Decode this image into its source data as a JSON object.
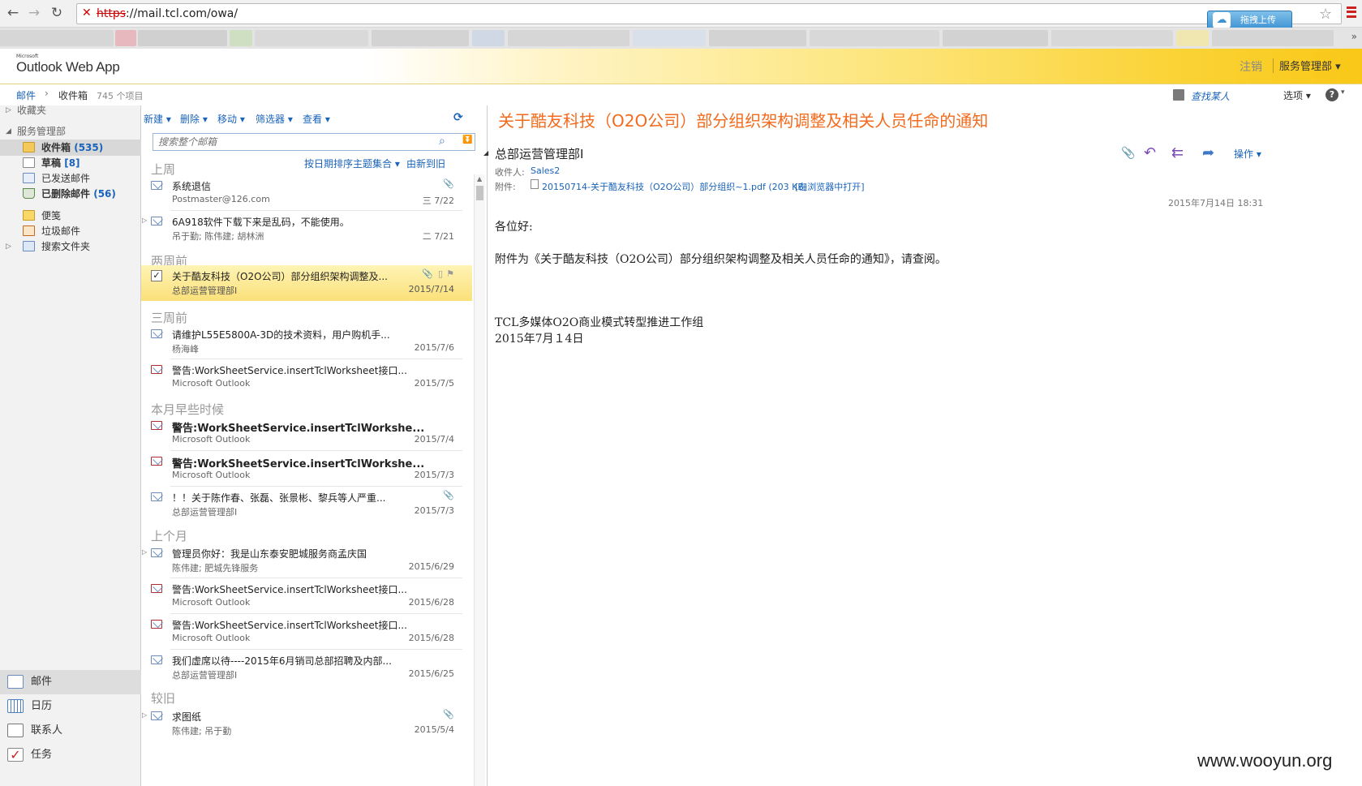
{
  "browser": {
    "url_scheme": "https",
    "url_rest": "://mail.tcl.com/owa/",
    "upload_label": "拖拽上传"
  },
  "header": {
    "logo_small": "Microsoft",
    "logo": "Outlook Web App",
    "logout": "注销",
    "user": "服务管理部 ▾"
  },
  "breadcrumb": {
    "mail": "邮件",
    "sep": "›",
    "inbox": "收件箱",
    "count": "745 个项目",
    "find_people": "查找某人",
    "options": "选项 ▾",
    "help": "?"
  },
  "nav": {
    "favorites": "收藏夹",
    "mailbox": "服务管理部",
    "folders": [
      {
        "label": "收件箱",
        "count": "(535)",
        "bold": true
      },
      {
        "label": "草稿",
        "count": "[8]",
        "bold": true
      },
      {
        "label": "已发送邮件",
        "count": "",
        "bold": false
      },
      {
        "label": "已删除邮件",
        "count": "(56)",
        "bold": true
      },
      {
        "label": "便笺",
        "count": "",
        "bold": false
      },
      {
        "label": "垃圾邮件",
        "count": "",
        "bold": false
      },
      {
        "label": "搜索文件夹",
        "count": "",
        "bold": false
      }
    ],
    "dots": "......",
    "bottom": [
      "邮件",
      "日历",
      "联系人",
      "任务"
    ]
  },
  "list": {
    "toolbar": [
      "新建 ▾",
      "删除 ▾",
      "移动 ▾",
      "筛选器 ▾",
      "查看 ▾"
    ],
    "search_placeholder": "搜索整个邮箱",
    "sort_by": "按日期排序主题集合 ▾",
    "sort_order": "由新到旧",
    "groups": [
      "上周",
      "两周前",
      "三周前",
      "本月早些时候",
      "上个月",
      "较旧"
    ],
    "items": [
      {
        "subject": "系统退信",
        "from": "Postmaster@126.com",
        "date": "三 7/22",
        "attach": true,
        "alert": false,
        "bold": false,
        "thread": false
      },
      {
        "subject": "6A918软件下载下来是乱码，不能使用。",
        "from": "吊于勤; 陈伟建; 胡林洲",
        "date": "二 7/21",
        "attach": false,
        "alert": false,
        "bold": false,
        "thread": true
      },
      {
        "subject": "关于酷友科技（O2O公司）部分组织架构调整及...",
        "from": "总部运营管理部I",
        "date": "2015/7/14",
        "attach": true,
        "alert": false,
        "bold": false,
        "thread": false
      },
      {
        "subject": "请维护L55E5800A-3D的技术资料，用户购机手...",
        "from": "杨海峰",
        "date": "2015/7/6",
        "attach": false,
        "alert": false,
        "bold": false,
        "thread": false
      },
      {
        "subject": "警告:WorkSheetService.insertTclWorksheet接口...",
        "from": "Microsoft Outlook",
        "date": "2015/7/5",
        "attach": false,
        "alert": true,
        "bold": false,
        "thread": false
      },
      {
        "subject": "警告:WorkSheetService.insertTclWorkshe...",
        "from": "Microsoft Outlook",
        "date": "2015/7/4",
        "attach": false,
        "alert": true,
        "bold": true,
        "thread": false
      },
      {
        "subject": "警告:WorkSheetService.insertTclWorkshe...",
        "from": "Microsoft Outlook",
        "date": "2015/7/3",
        "attach": false,
        "alert": true,
        "bold": true,
        "thread": false
      },
      {
        "subject": "！！关于陈作春、张磊、张景彬、黎兵等人严重...",
        "from": "总部运营管理部I",
        "date": "2015/7/3",
        "attach": true,
        "alert": false,
        "bold": false,
        "thread": false
      },
      {
        "subject": "管理员你好：我是山东泰安肥城服务商孟庆国",
        "from": "陈伟建; 肥城先锋服务",
        "date": "2015/6/29",
        "attach": false,
        "alert": false,
        "bold": false,
        "thread": true
      },
      {
        "subject": "警告:WorkSheetService.insertTclWorksheet接口...",
        "from": "Microsoft Outlook",
        "date": "2015/6/28",
        "attach": false,
        "alert": true,
        "bold": false,
        "thread": false
      },
      {
        "subject": "警告:WorkSheetService.insertTclWorksheet接口...",
        "from": "Microsoft Outlook",
        "date": "2015/6/28",
        "attach": false,
        "alert": true,
        "bold": false,
        "thread": false
      },
      {
        "subject": "我们虚席以待----2015年6月销司总部招聘及内部...",
        "from": "总部运营管理部I",
        "date": "2015/6/25",
        "attach": false,
        "alert": false,
        "bold": false,
        "thread": false
      },
      {
        "subject": "求图纸",
        "from": "陈伟建; 吊于勤",
        "date": "2015/5/4",
        "attach": true,
        "alert": false,
        "bold": false,
        "thread": true
      }
    ]
  },
  "reading": {
    "subject": "关于酷友科技（O2O公司）部分组织架构调整及相关人员任命的通知",
    "sender": "总部运营管理部I",
    "to_label": "收件人:",
    "to": "Sales2",
    "att_label": "附件:",
    "att_file": "20150714-关于酷友科技（O2O公司）部分组织~1.pdf (203 KB)",
    "att_open": "[在浏览器中打开]",
    "actions_label": "操作 ▾",
    "date": "2015年7月14日 18:31",
    "body_greeting": "各位好:",
    "body_line1": "附件为《关于酷友科技（O2O公司）部分组织架构调整及相关人员任命的通知》，请查阅。",
    "body_sig1": "TCL多媒体O2O商业模式转型推进工作组",
    "body_sig2": "2015年7月１4日"
  },
  "watermark": "www.wooyun.org",
  "colors": {
    "accent_blue": "#1a63ba",
    "subject_orange": "#f26b1d",
    "selected_yellow": "#fbe07a"
  }
}
